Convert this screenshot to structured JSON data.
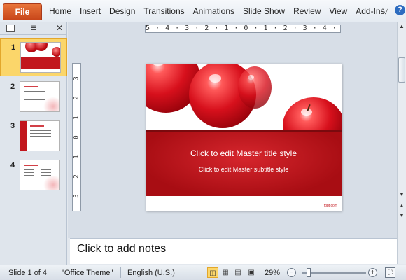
{
  "ribbon": {
    "file_tab": "File",
    "tabs": [
      "Home",
      "Insert",
      "Design",
      "Transitions",
      "Animations",
      "Slide Show",
      "Review",
      "View",
      "Add-Ins"
    ],
    "help": "?"
  },
  "panel": {
    "slides_tab_icon": "slides-view-icon",
    "outline_tab_icon": "outline-view-icon",
    "close_icon": "close-icon",
    "thumbnails": [
      {
        "number": "1",
        "selected": true
      },
      {
        "number": "2",
        "selected": false
      },
      {
        "number": "3",
        "selected": false
      },
      {
        "number": "4",
        "selected": false
      }
    ]
  },
  "ruler": {
    "horizontal": "5 · 4 · 3 · 2 · 1 · 0 · 1 · 2 · 3 · 4 · 5",
    "vertical": [
      "3",
      "2",
      "1",
      "0",
      "1",
      "2",
      "3"
    ]
  },
  "slide": {
    "title": "Click to edit Master title style",
    "subtitle": "Click to edit Master subtitle style",
    "logo": "fppt.com",
    "band_color": "#c2161d"
  },
  "notes": {
    "placeholder": "Click to add notes"
  },
  "status": {
    "slide_counter": "Slide 1 of 4",
    "theme": "\"Office Theme\"",
    "language": "English (U.S.)",
    "zoom_level": "29%",
    "zoom_fraction": 0.29
  }
}
